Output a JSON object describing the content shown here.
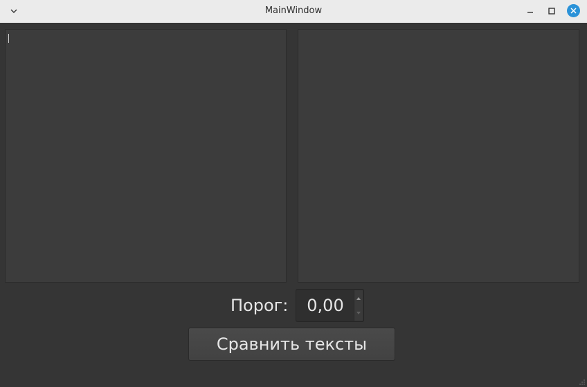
{
  "window": {
    "title": "MainWindow",
    "accent_color": "#2a92d8"
  },
  "titlebar": {
    "menu_icon": "chevron-down-icon",
    "minimize_icon": "minimize-icon",
    "maximize_icon": "maximize-icon",
    "close_icon": "close-icon"
  },
  "editors": {
    "left_text": "",
    "right_text": ""
  },
  "threshold": {
    "label": "Порог:",
    "value": "0,00"
  },
  "actions": {
    "compare_label": "Сравнить тексты"
  }
}
